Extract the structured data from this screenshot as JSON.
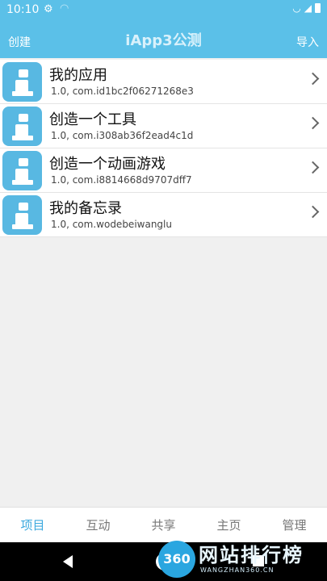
{
  "status_bar": {
    "time": "10:10",
    "icons": [
      "gear-icon",
      "wifi-icon",
      "signal-icon",
      "battery-icon"
    ]
  },
  "appbar": {
    "left_action": "创建",
    "title": "iApp3公测",
    "right_action": "导入"
  },
  "projects": [
    {
      "name": "我的应用",
      "subtitle": "1.0, com.id1bc2f06271268e3"
    },
    {
      "name": "创造一个工具",
      "subtitle": "1.0, com.i308ab36f2ead4c1d"
    },
    {
      "name": "创造一个动画游戏",
      "subtitle": "1.0, com.i8814668d9707dff7"
    },
    {
      "name": "我的备忘录",
      "subtitle": "1.0, com.wodebeiwanglu"
    }
  ],
  "tabs": [
    {
      "label": "项目",
      "active": true
    },
    {
      "label": "互动",
      "active": false
    },
    {
      "label": "共享",
      "active": false
    },
    {
      "label": "主页",
      "active": false
    },
    {
      "label": "管理",
      "active": false
    }
  ],
  "watermark": {
    "badge": "360",
    "name": "网站排行榜",
    "url": "WANGZHAN360.CN"
  },
  "colors": {
    "accent": "#5bc0e8",
    "active_tab": "#3ca9de",
    "icon_bg": "#58b8e2"
  }
}
